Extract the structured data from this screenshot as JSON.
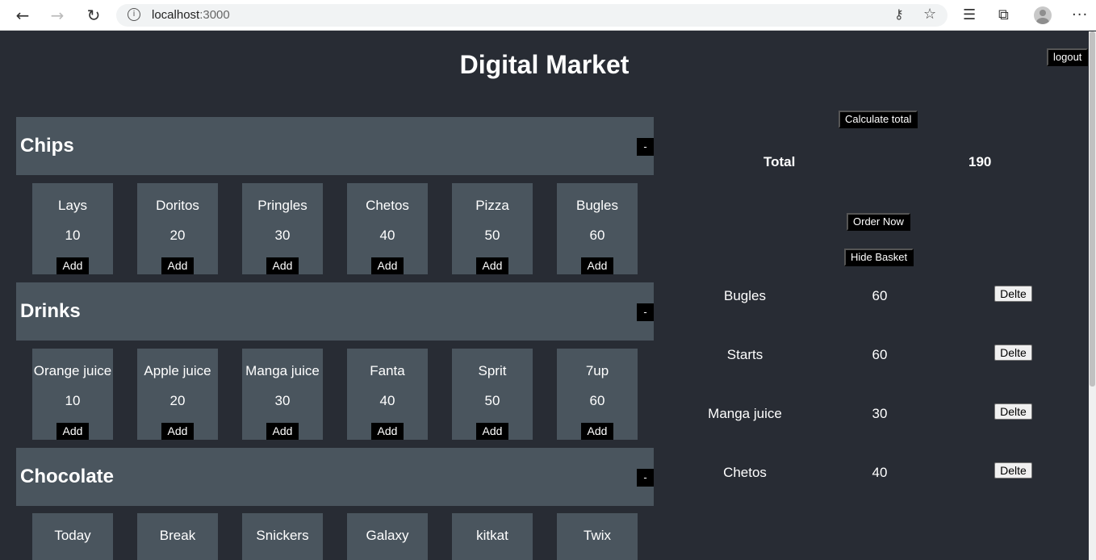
{
  "browser": {
    "url_host": "localhost",
    "url_port": ":3000"
  },
  "app": {
    "title": "Digital Market",
    "logout_label": "logout"
  },
  "categories": [
    {
      "name": "Chips",
      "toggle_label": "-",
      "items": [
        {
          "name": "Lays",
          "price": "10",
          "add_label": "Add"
        },
        {
          "name": "Doritos",
          "price": "20",
          "add_label": "Add"
        },
        {
          "name": "Pringles",
          "price": "30",
          "add_label": "Add"
        },
        {
          "name": "Chetos",
          "price": "40",
          "add_label": "Add"
        },
        {
          "name": "Pizza",
          "price": "50",
          "add_label": "Add"
        },
        {
          "name": "Bugles",
          "price": "60",
          "add_label": "Add"
        }
      ]
    },
    {
      "name": "Drinks",
      "toggle_label": "-",
      "items": [
        {
          "name": "Orange juice",
          "price": "10",
          "add_label": "Add"
        },
        {
          "name": "Apple juice",
          "price": "20",
          "add_label": "Add"
        },
        {
          "name": "Manga juice",
          "price": "30",
          "add_label": "Add"
        },
        {
          "name": "Fanta",
          "price": "40",
          "add_label": "Add"
        },
        {
          "name": "Sprit",
          "price": "50",
          "add_label": "Add"
        },
        {
          "name": "7up",
          "price": "60",
          "add_label": "Add"
        }
      ]
    },
    {
      "name": "Chocolate",
      "toggle_label": "-",
      "items": [
        {
          "name": "Today"
        },
        {
          "name": "Break"
        },
        {
          "name": "Snickers"
        },
        {
          "name": "Galaxy"
        },
        {
          "name": "kitkat"
        },
        {
          "name": "Twix"
        }
      ]
    }
  ],
  "basket": {
    "calculate_label": "Calculate total",
    "total_label": "Total",
    "total_value": "190",
    "order_label": "Order Now",
    "hide_label": "Hide Basket",
    "delete_label": "Delte",
    "items": [
      {
        "name": "Bugles",
        "price": "60"
      },
      {
        "name": "Starts",
        "price": "60"
      },
      {
        "name": "Manga juice",
        "price": "30"
      },
      {
        "name": "Chetos",
        "price": "40"
      }
    ]
  }
}
